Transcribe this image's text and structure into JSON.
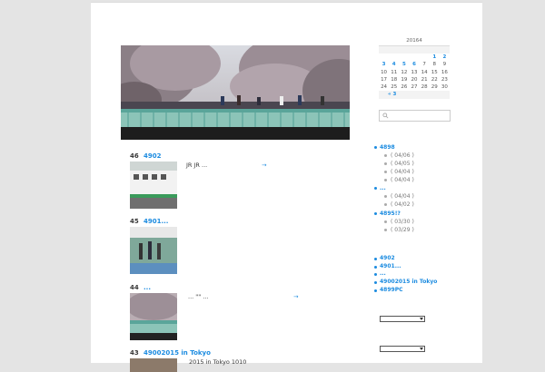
{
  "posts": [
    {
      "num": "46",
      "title": "4902",
      "excerpt": "JR JR ...",
      "more": "→",
      "more_offset": "83"
    },
    {
      "num": "45",
      "title": "4901...",
      "excerpt": "",
      "more": ""
    },
    {
      "num": "44",
      "title": "...",
      "excerpt": "...  \"\"  ...",
      "more": "→"
    },
    {
      "num": "43",
      "title": "49002015 in Tokyo",
      "excerpt": "2015 in Tokyo 1010",
      "more": ""
    }
  ],
  "calendar": {
    "caption": "20164",
    "rows": [
      [
        "",
        "",
        "",
        "",
        "",
        "1",
        "2"
      ],
      [
        "3",
        "4",
        "5",
        "6",
        "7",
        "8",
        "9"
      ],
      [
        "10",
        "11",
        "12",
        "13",
        "14",
        "15",
        "16"
      ],
      [
        "17",
        "18",
        "19",
        "20",
        "21",
        "22",
        "23"
      ],
      [
        "24",
        "25",
        "26",
        "27",
        "28",
        "29",
        "30"
      ]
    ],
    "linked_days": [
      "1",
      "2",
      "3",
      "4",
      "5",
      "6"
    ],
    "prev": "« 3"
  },
  "archive": {
    "groups": [
      {
        "title": "4898",
        "items": [
          "( 04/06 )",
          "( 04/05 )",
          "( 04/04 )",
          "( 04/04 )"
        ]
      },
      {
        "title": "...",
        "items": [
          "( 04/04 )",
          "( 04/02 )"
        ]
      },
      {
        "title": "4895!?",
        "items": [
          "( 03/30 )",
          "( 03/29 )"
        ]
      }
    ]
  },
  "recent_posts": [
    "4902",
    "4901...",
    "...",
    "49002015 in Tokyo",
    "4899PC"
  ],
  "colors": {
    "link": "#1b8be0",
    "background": "#e4e4e4",
    "page": "#ffffff"
  }
}
